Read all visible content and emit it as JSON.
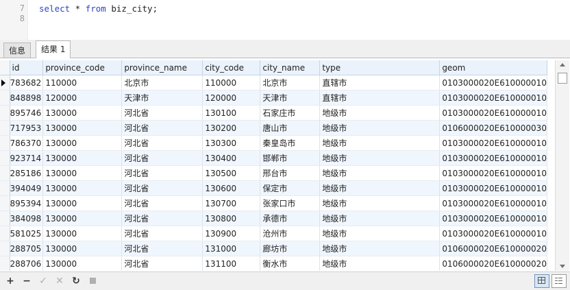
{
  "editor": {
    "lines": [
      {
        "num": "7",
        "kw1": "select",
        "mid": " * ",
        "kw2": "from",
        "rest": " biz_city;"
      },
      {
        "num": "8"
      }
    ]
  },
  "tabs": [
    "信息",
    "结果 1"
  ],
  "active_tab": "结果 1",
  "grid": {
    "columns": [
      "id",
      "province_code",
      "province_name",
      "city_code",
      "city_name",
      "type",
      "geom"
    ],
    "rows": [
      [
        "783682",
        "110000",
        "北京市",
        "110000",
        "北京市",
        "直辖市",
        "0103000020E610000010"
      ],
      [
        "848898",
        "120000",
        "天津市",
        "120000",
        "天津市",
        "直辖市",
        "0103000020E610000010"
      ],
      [
        "895746",
        "130000",
        "河北省",
        "130100",
        "石家庄市",
        "地级市",
        "0103000020E610000010"
      ],
      [
        "717953",
        "130000",
        "河北省",
        "130200",
        "唐山市",
        "地级市",
        "0106000020E610000030"
      ],
      [
        "786370",
        "130000",
        "河北省",
        "130300",
        "秦皇岛市",
        "地级市",
        "0103000020E610000010"
      ],
      [
        "923714",
        "130000",
        "河北省",
        "130400",
        "邯郸市",
        "地级市",
        "0103000020E610000010"
      ],
      [
        "285186",
        "130000",
        "河北省",
        "130500",
        "邢台市",
        "地级市",
        "0103000020E610000010"
      ],
      [
        "394049",
        "130000",
        "河北省",
        "130600",
        "保定市",
        "地级市",
        "0103000020E610000010"
      ],
      [
        "895394",
        "130000",
        "河北省",
        "130700",
        "张家口市",
        "地级市",
        "0103000020E610000010"
      ],
      [
        "384098",
        "130000",
        "河北省",
        "130800",
        "承德市",
        "地级市",
        "0103000020E610000010"
      ],
      [
        "581025",
        "130000",
        "河北省",
        "130900",
        "沧州市",
        "地级市",
        "0103000020E610000010"
      ],
      [
        "288705",
        "130000",
        "河北省",
        "131000",
        "廊坊市",
        "地级市",
        "0106000020E610000020"
      ],
      [
        "288706",
        "130000",
        "河北省",
        "131100",
        "衡水市",
        "地级市",
        "0106000020E610000020"
      ]
    ]
  },
  "toolbar": {
    "add_icon": "plus-icon",
    "delete_icon": "minus-icon",
    "apply_icon": "check-icon",
    "discard_icon": "x-icon",
    "refresh_icon": "refresh-icon",
    "stop_icon": "stop-icon",
    "grid_view_icon": "grid-view-icon",
    "form_view_icon": "form-view-icon"
  },
  "colors": {
    "keyword": "#2d45c9",
    "header_bg": "#eaf2fb",
    "selected_row_bg": "#f0f6fd"
  }
}
